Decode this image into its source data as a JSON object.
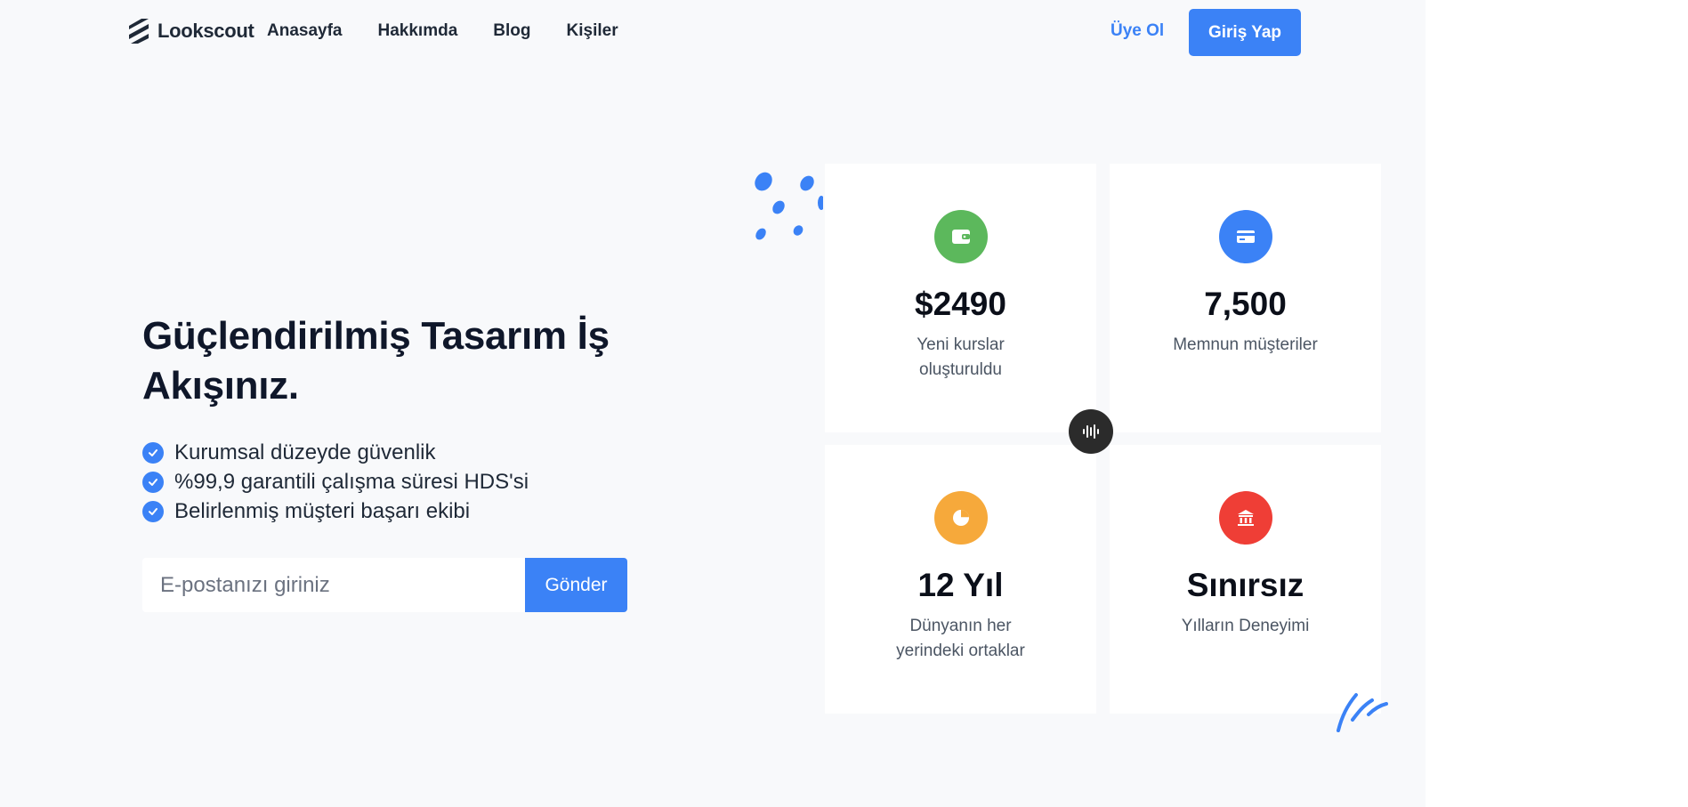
{
  "brand": {
    "name": "Lookscout"
  },
  "nav": {
    "items": [
      {
        "label": "Anasayfa"
      },
      {
        "label": "Hakkımda"
      },
      {
        "label": "Blog"
      },
      {
        "label": "Kişiler"
      }
    ],
    "signup_label": "Üye Ol",
    "login_label": "Giriş Yap"
  },
  "hero": {
    "title": "Güçlendirilmiş Tasarım İş Akışınız.",
    "features": [
      "Kurumsal düzeyde güvenlik",
      "%99,9 garantili çalışma süresi HDS'si",
      "Belirlenmiş müşteri başarı ekibi"
    ],
    "email_placeholder": "E-postanızı giriniz",
    "send_label": "Gönder"
  },
  "stats": [
    {
      "icon": "wallet-icon",
      "color": "#5cb85c",
      "value": "$2490",
      "label": "Yeni kurslar oluşturuldu"
    },
    {
      "icon": "credit-card-icon",
      "color": "#3b82f6",
      "value": "7,500",
      "label": "Memnun müşteriler"
    },
    {
      "icon": "pie-chart-icon",
      "color": "#f6a93b",
      "value": "12 Yıl",
      "label": "Dünyanın her yerindeki ortaklar"
    },
    {
      "icon": "bank-icon",
      "color": "#ef3e36",
      "value": "Sınırsız",
      "label": "Yılların Deneyimi"
    }
  ],
  "colors": {
    "accent": "#3b82f6",
    "badge": "#2b2b2b",
    "background": "#f8f9fb"
  }
}
